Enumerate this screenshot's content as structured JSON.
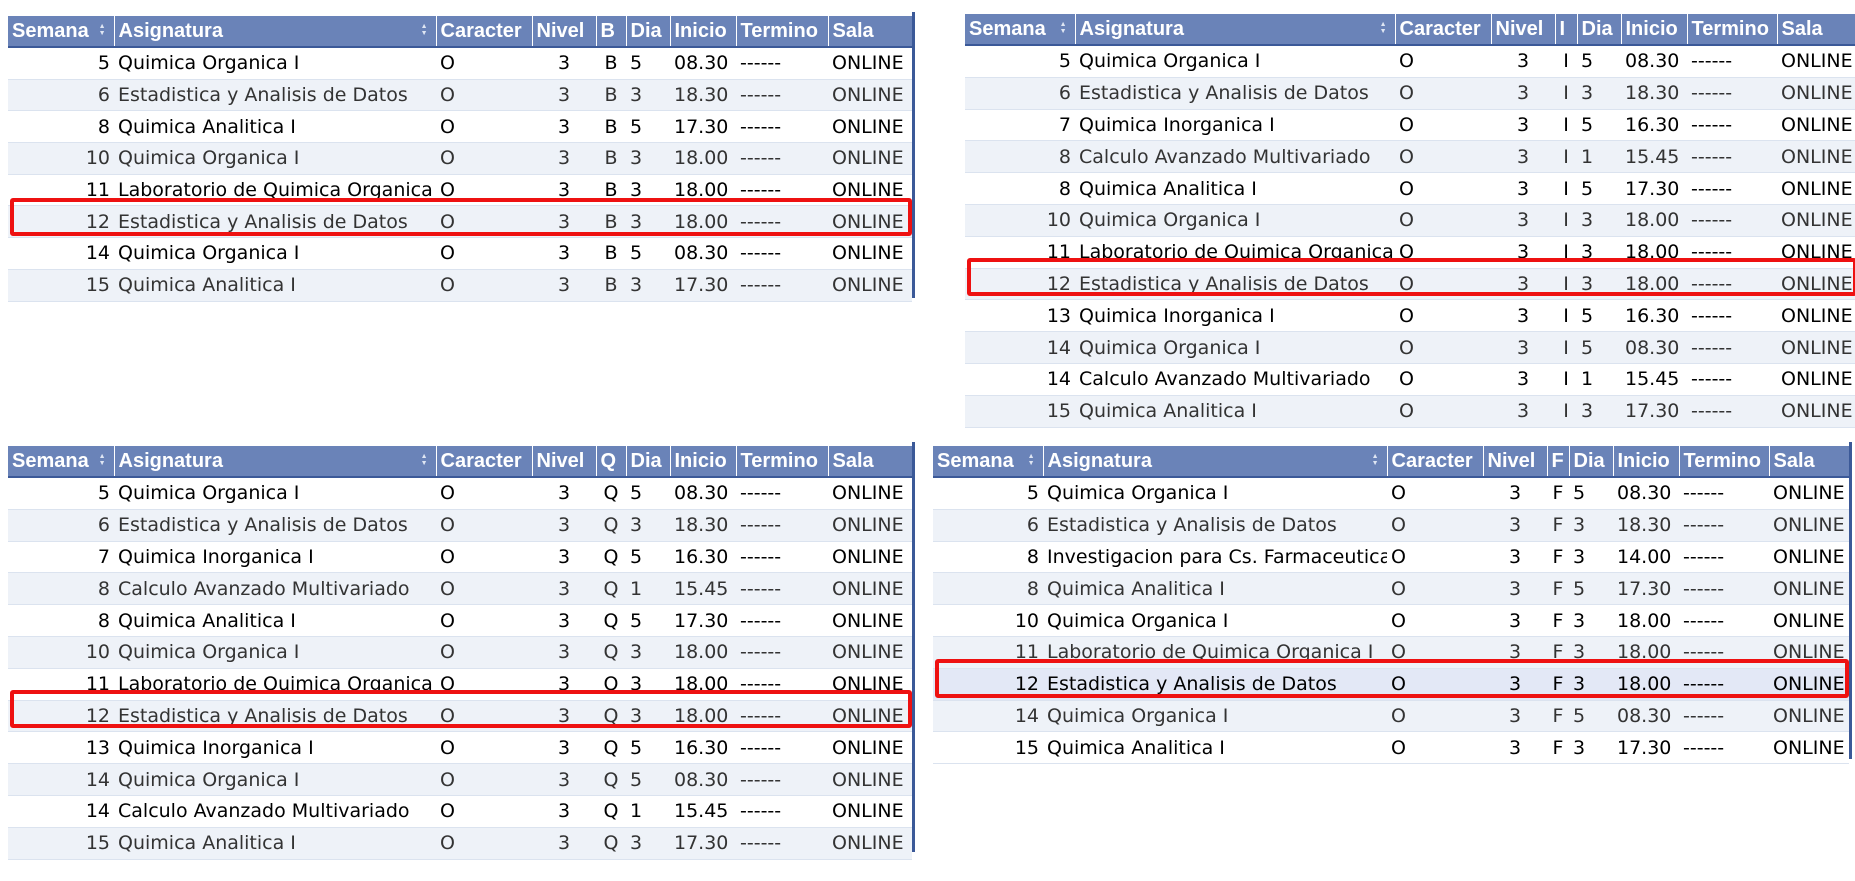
{
  "tables": [
    {
      "id": "B",
      "headers": [
        "Semana",
        "Asignatura",
        "Caracter",
        "Nivel",
        "B",
        "Dia",
        "Inicio",
        "Termino",
        "Sala"
      ],
      "rows": [
        [
          "5",
          "Quimica Organica I",
          "O",
          "3",
          "B",
          "5",
          "08.30",
          "------",
          "ONLINE"
        ],
        [
          "6",
          "Estadistica y Analisis de Datos",
          "O",
          "3",
          "B",
          "3",
          "18.30",
          "------",
          "ONLINE"
        ],
        [
          "8",
          "Quimica Analitica I",
          "O",
          "3",
          "B",
          "5",
          "17.30",
          "------",
          "ONLINE"
        ],
        [
          "10",
          "Quimica Organica I",
          "O",
          "3",
          "B",
          "3",
          "18.00",
          "------",
          "ONLINE"
        ],
        [
          "11",
          "Laboratorio de Quimica Organica I",
          "O",
          "3",
          "B",
          "3",
          "18.00",
          "------",
          "ONLINE"
        ],
        [
          "12",
          "Estadistica y Analisis de Datos",
          "O",
          "3",
          "B",
          "3",
          "18.00",
          "------",
          "ONLINE"
        ],
        [
          "14",
          "Quimica Organica I",
          "O",
          "3",
          "B",
          "5",
          "08.30",
          "------",
          "ONLINE"
        ],
        [
          "15",
          "Quimica Analitica I",
          "O",
          "3",
          "B",
          "3",
          "17.30",
          "------",
          "ONLINE"
        ]
      ],
      "highlight_row": 5
    },
    {
      "id": "I",
      "headers": [
        "Semana",
        "Asignatura",
        "Caracter",
        "Nivel",
        "I",
        "Dia",
        "Inicio",
        "Termino",
        "Sala"
      ],
      "rows": [
        [
          "5",
          "Quimica Organica I",
          "O",
          "3",
          "I",
          "5",
          "08.30",
          "------",
          "ONLINE"
        ],
        [
          "6",
          "Estadistica y Analisis de Datos",
          "O",
          "3",
          "I",
          "3",
          "18.30",
          "------",
          "ONLINE"
        ],
        [
          "7",
          "Quimica Inorganica I",
          "O",
          "3",
          "I",
          "5",
          "16.30",
          "------",
          "ONLINE"
        ],
        [
          "8",
          "Calculo Avanzado Multivariado",
          "O",
          "3",
          "I",
          "1",
          "15.45",
          "------",
          "ONLINE"
        ],
        [
          "8",
          "Quimica Analitica I",
          "O",
          "3",
          "I",
          "5",
          "17.30",
          "------",
          "ONLINE"
        ],
        [
          "10",
          "Quimica Organica I",
          "O",
          "3",
          "I",
          "3",
          "18.00",
          "------",
          "ONLINE"
        ],
        [
          "11",
          "Laboratorio de Quimica Organica I",
          "O",
          "3",
          "I",
          "3",
          "18.00",
          "------",
          "ONLINE"
        ],
        [
          "12",
          "Estadistica y Analisis de Datos",
          "O",
          "3",
          "I",
          "3",
          "18.00",
          "------",
          "ONLINE"
        ],
        [
          "13",
          "Quimica Inorganica I",
          "O",
          "3",
          "I",
          "5",
          "16.30",
          "------",
          "ONLINE"
        ],
        [
          "14",
          "Quimica Organica I",
          "O",
          "3",
          "I",
          "5",
          "08.30",
          "------",
          "ONLINE"
        ],
        [
          "14",
          "Calculo Avanzado Multivariado",
          "O",
          "3",
          "I",
          "1",
          "15.45",
          "------",
          "ONLINE"
        ],
        [
          "15",
          "Quimica Analitica I",
          "O",
          "3",
          "I",
          "3",
          "17.30",
          "------",
          "ONLINE"
        ]
      ],
      "highlight_row": 7
    },
    {
      "id": "Q",
      "headers": [
        "Semana",
        "Asignatura",
        "Caracter",
        "Nivel",
        "Q",
        "Dia",
        "Inicio",
        "Termino",
        "Sala"
      ],
      "rows": [
        [
          "5",
          "Quimica Organica I",
          "O",
          "3",
          "Q",
          "5",
          "08.30",
          "------",
          "ONLINE"
        ],
        [
          "6",
          "Estadistica y Analisis de Datos",
          "O",
          "3",
          "Q",
          "3",
          "18.30",
          "------",
          "ONLINE"
        ],
        [
          "7",
          "Quimica Inorganica I",
          "O",
          "3",
          "Q",
          "5",
          "16.30",
          "------",
          "ONLINE"
        ],
        [
          "8",
          "Calculo Avanzado Multivariado",
          "O",
          "3",
          "Q",
          "1",
          "15.45",
          "------",
          "ONLINE"
        ],
        [
          "8",
          "Quimica Analitica I",
          "O",
          "3",
          "Q",
          "5",
          "17.30",
          "------",
          "ONLINE"
        ],
        [
          "10",
          "Quimica Organica I",
          "O",
          "3",
          "Q",
          "3",
          "18.00",
          "------",
          "ONLINE"
        ],
        [
          "11",
          "Laboratorio de Quimica Organica I",
          "O",
          "3",
          "Q",
          "3",
          "18.00",
          "------",
          "ONLINE"
        ],
        [
          "12",
          "Estadistica y Analisis de Datos",
          "O",
          "3",
          "Q",
          "3",
          "18.00",
          "------",
          "ONLINE"
        ],
        [
          "13",
          "Quimica Inorganica I",
          "O",
          "3",
          "Q",
          "5",
          "16.30",
          "------",
          "ONLINE"
        ],
        [
          "14",
          "Quimica Organica I",
          "O",
          "3",
          "Q",
          "5",
          "08.30",
          "------",
          "ONLINE"
        ],
        [
          "14",
          "Calculo Avanzado Multivariado",
          "O",
          "3",
          "Q",
          "1",
          "15.45",
          "------",
          "ONLINE"
        ],
        [
          "15",
          "Quimica Analitica I",
          "O",
          "3",
          "Q",
          "3",
          "17.30",
          "------",
          "ONLINE"
        ]
      ],
      "highlight_row": 7
    },
    {
      "id": "F",
      "headers": [
        "Semana",
        "Asignatura",
        "Caracter",
        "Nivel",
        "F",
        "Dia",
        "Inicio",
        "Termino",
        "Sala"
      ],
      "rows": [
        [
          "5",
          "Quimica Organica I",
          "O",
          "3",
          "F",
          "5",
          "08.30",
          "------",
          "ONLINE"
        ],
        [
          "6",
          "Estadistica y Analisis de Datos",
          "O",
          "3",
          "F",
          "3",
          "18.30",
          "------",
          "ONLINE"
        ],
        [
          "8",
          "Investigacion para Cs. Farmaceuticas",
          "O",
          "3",
          "F",
          "3",
          "14.00",
          "------",
          "ONLINE"
        ],
        [
          "8",
          "Quimica Analitica I",
          "O",
          "3",
          "F",
          "5",
          "17.30",
          "------",
          "ONLINE"
        ],
        [
          "10",
          "Quimica Organica I",
          "O",
          "3",
          "F",
          "3",
          "18.00",
          "------",
          "ONLINE"
        ],
        [
          "11",
          "Laboratorio de Quimica Organica I",
          "O",
          "3",
          "F",
          "3",
          "18.00",
          "------",
          "ONLINE"
        ],
        [
          "12",
          "Estadistica y Analisis de Datos",
          "O",
          "3",
          "F",
          "3",
          "18.00",
          "------",
          "ONLINE"
        ],
        [
          "14",
          "Quimica Organica I",
          "O",
          "3",
          "F",
          "5",
          "08.30",
          "------",
          "ONLINE"
        ],
        [
          "15",
          "Quimica Analitica I",
          "O",
          "3",
          "F",
          "3",
          "17.30",
          "------",
          "ONLINE"
        ]
      ],
      "highlight_row": 6
    }
  ],
  "colors": {
    "header_bg": "#6a83b8",
    "header_text": "#ffffff",
    "row_alt_bg": "#eef2f8",
    "highlight_border": "#ee1111"
  },
  "icons": {
    "sort": "sort-arrows-icon"
  }
}
